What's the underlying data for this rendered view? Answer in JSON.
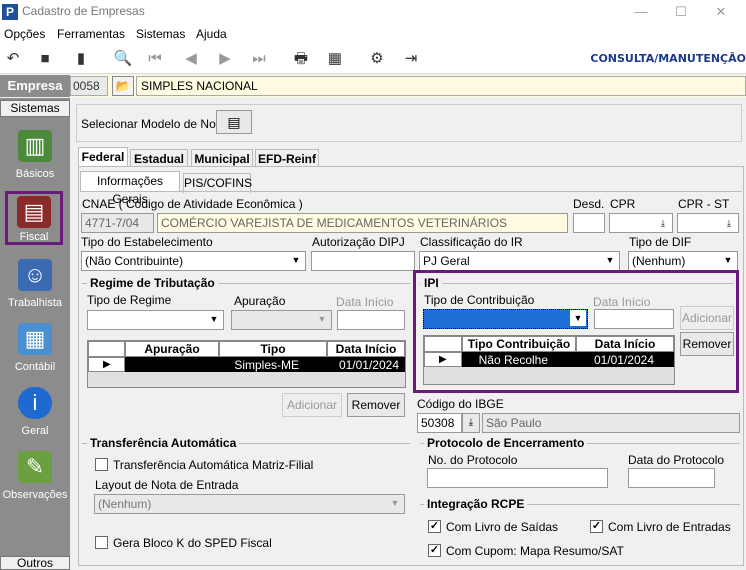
{
  "window": {
    "title": "Cadastro de Empresas",
    "app_icon": "P"
  },
  "menu": [
    "Opções",
    "Ferramentas",
    "Sistemas",
    "Ajuda"
  ],
  "toolbar": {
    "mode": "CONSULTA/MANUTENÇÃO"
  },
  "empresa": {
    "label": "Empresa",
    "code": "0058",
    "name": "SIMPLES NACIONAL"
  },
  "sidebar": {
    "header": "Sistemas",
    "footer": "Outros",
    "items": [
      {
        "label": "Básicos"
      },
      {
        "label": "Fiscal"
      },
      {
        "label": "Trabalhista"
      },
      {
        "label": "Contábil"
      },
      {
        "label": "Geral"
      },
      {
        "label": "Observações"
      }
    ]
  },
  "modelo": {
    "label": "Selecionar Modelo de Nota"
  },
  "tabs": [
    "Federal",
    "Estadual",
    "Municipal",
    "EFD-Reinf"
  ],
  "subtabs": [
    "Informações Gerais",
    "PIS/COFINS"
  ],
  "cnae": {
    "label": "CNAE ( Código de  Atividade Econômica )",
    "code": "4771-7/04",
    "desc": "COMÉRCIO VAREJISTA DE MEDICAMENTOS VETERINÁRIOS"
  },
  "desd": {
    "label": "Desd."
  },
  "cpr": {
    "label": "CPR"
  },
  "cpr_st": {
    "label": "CPR - ST"
  },
  "tipo_estab": {
    "label": "Tipo do Estabelecimento",
    "value": "(Não Contribuinte)"
  },
  "aut_dipj": {
    "label": "Autorização DIPJ"
  },
  "class_ir": {
    "label": "Classificação do IR",
    "value": "PJ Geral"
  },
  "tipo_dif": {
    "label": "Tipo de DIF",
    "value": "(Nenhum)"
  },
  "regime": {
    "title": "Regime de Tributação",
    "tipo_label": "Tipo de Regime",
    "apuracao_label": "Apuração",
    "data_label": "Data Início",
    "columns": [
      "Apuração",
      "Tipo",
      "Data Início"
    ],
    "row": {
      "apuracao": "",
      "tipo": "Simples-ME",
      "data": "01/01/2024"
    },
    "add_label": "Adicionar",
    "remove_label": "Remover"
  },
  "ipi": {
    "title": "IPI",
    "tipo_label": "Tipo de Contribuição",
    "data_label": "Data Início",
    "columns": [
      "Tipo Contribuição",
      "Data Início"
    ],
    "row": {
      "tipo": "Não Recolhe",
      "data": "01/01/2024"
    },
    "add_label": "Adicionar",
    "remove_label": "Remover"
  },
  "ibge": {
    "label": "Código do IBGE",
    "code": "50308",
    "city": "São Paulo"
  },
  "transf": {
    "title": "Transferência Automática",
    "check_label": "Transferência Automática Matriz-Filial",
    "layout_label": "Layout de Nota de Entrada",
    "layout_value": "(Nenhum)"
  },
  "bloco_k": {
    "label": "Gera Bloco K do SPED Fiscal"
  },
  "protocolo": {
    "title": "Protocolo de Encerramento",
    "num_label": "No. do Protocolo",
    "data_label": "Data do Protocolo"
  },
  "rcpe": {
    "title": "Integração RCPE",
    "saidas": "Com Livro de Saídas",
    "entradas": "Com Livro de Entradas",
    "cupom": "Com Cupom: Mapa Resumo/SAT"
  }
}
